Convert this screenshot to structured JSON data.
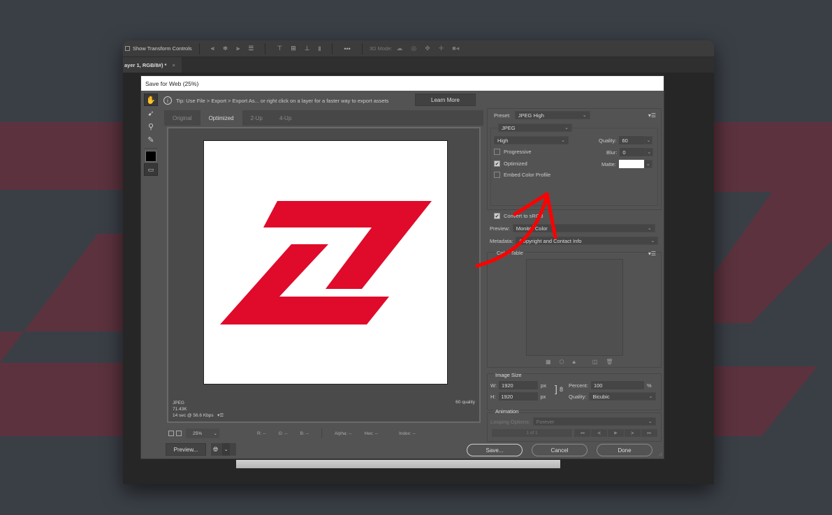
{
  "background": {
    "accent": "#5b323d",
    "base": "#3a3f46"
  },
  "photoshop": {
    "options_bar": {
      "show_transform_controls": "Show Transform Controls",
      "three_d_mode": "3D Mode:",
      "more": "•••"
    },
    "document_tab": {
      "title": "ayer 1, RGB/8#) *",
      "close": "×"
    }
  },
  "dialog": {
    "title": "Save for Web (25%)",
    "tip": "Tip: Use File > Export > Export As...  or right click on a layer for a faster way to export assets",
    "learn_more": "Learn More",
    "tools": [
      "hand-tool",
      "slice-select-tool",
      "zoom-tool",
      "eyedropper-tool",
      "eyedropper-color",
      "toggle-slices"
    ],
    "view_tabs": [
      {
        "label": "Original",
        "active": false
      },
      {
        "label": "Optimized",
        "active": true
      },
      {
        "label": "2-Up",
        "active": false
      },
      {
        "label": "4-Up",
        "active": false
      }
    ],
    "image_info": {
      "format": "JPEG",
      "size": "71.43K",
      "speed": "14 sec @ 56.6 Kbps",
      "quality": "60 quality"
    },
    "logo_color": "#e00a2a",
    "status": {
      "zoom": "25%",
      "r": "R: --",
      "g": "G: --",
      "b": "B: --",
      "alpha": "Alpha: --",
      "hex": "Hex: --",
      "index": "Index: --"
    },
    "preview_button": "Preview...",
    "save_button": "Save...",
    "cancel_button": "Cancel",
    "done_button": "Done",
    "settings": {
      "preset_label": "Preset:",
      "preset_value": "JPEG High",
      "format_value": "JPEG",
      "compression_value": "High",
      "quality_label": "Quality:",
      "quality_value": "60",
      "blur_label": "Blur:",
      "blur_value": "0",
      "matte_label": "Matte:",
      "matte_color": "#ffffff",
      "progressive": {
        "label": "Progressive",
        "checked": false
      },
      "optimized": {
        "label": "Optimized",
        "checked": true
      },
      "embed_color_profile": {
        "label": "Embed Color Profile",
        "checked": false
      },
      "convert_srgb": {
        "label": "Convert to sRGB",
        "checked": true
      },
      "preview_label": "Preview:",
      "preview_value": "Monitor Color",
      "metadata_label": "Metadata:",
      "metadata_value": "Copyright and Contact Info",
      "color_table_label": "Color Table"
    },
    "image_size": {
      "label": "Image Size",
      "w_label": "W:",
      "w_value": "1920",
      "h_label": "H:",
      "h_value": "1920",
      "unit": "px",
      "percent_label": "Percent:",
      "percent_value": "100",
      "percent_unit": "%",
      "quality_label": "Quality:",
      "quality_value": "Bicubic"
    },
    "animation": {
      "label": "Animation",
      "looping_label": "Looping Options:",
      "looping_value": "Forever",
      "frame": "1 of 1"
    }
  },
  "annotation": {
    "color": "#ff0000",
    "points_to": "Quality setting"
  }
}
